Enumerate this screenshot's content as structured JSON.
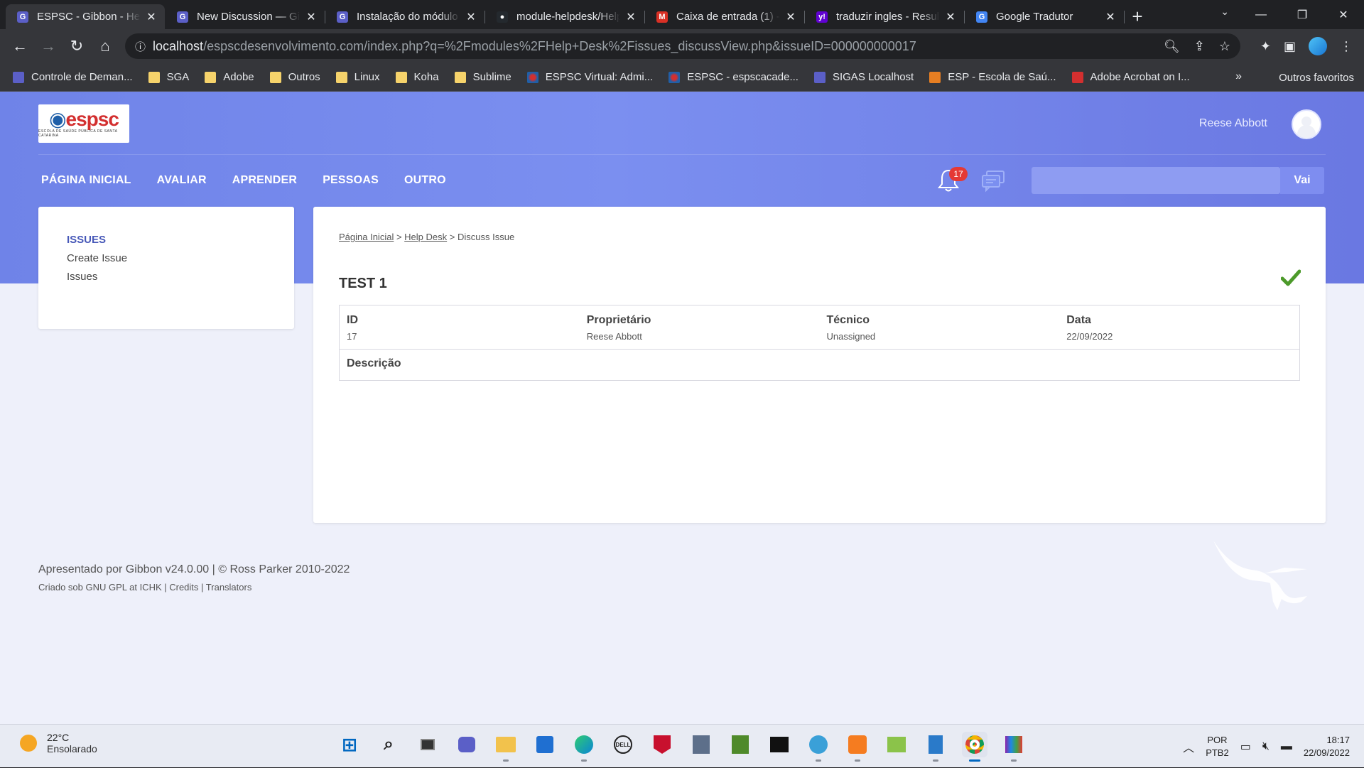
{
  "browser": {
    "tabs": [
      {
        "title": "ESPSC - Gibbon - Help Desk",
        "favicon": "G",
        "color": "#5b5fc7",
        "active": true
      },
      {
        "title": "New Discussion — Gibbon",
        "favicon": "G",
        "color": "#5b5fc7"
      },
      {
        "title": "Instalação do módulo",
        "favicon": "G",
        "color": "#5b5fc7"
      },
      {
        "title": "module-helpdesk/Help",
        "favicon": "●",
        "color": "#24292e"
      },
      {
        "title": "Caixa de entrada (1) -",
        "favicon": "M",
        "color": "#d93025"
      },
      {
        "title": "traduzir ingles - Resul",
        "favicon": "y!",
        "color": "#6001d2"
      },
      {
        "title": "Google Tradutor",
        "favicon": "G",
        "color": "#4285f4"
      }
    ],
    "url_host": "localhost",
    "url_path": "/espscdesenvolvimento.com/index.php?q=%2Fmodules%2FHelp+Desk%2Fissues_discussView.php&issueID=000000000017",
    "bookmarks": [
      {
        "label": "Controle de Deman...",
        "icon": "purple"
      },
      {
        "label": "SGA",
        "icon": "folder"
      },
      {
        "label": "Adobe",
        "icon": "folder"
      },
      {
        "label": "Outros",
        "icon": "folder"
      },
      {
        "label": "Linux",
        "icon": "folder"
      },
      {
        "label": "Koha",
        "icon": "folder"
      },
      {
        "label": "Sublime",
        "icon": "folder"
      },
      {
        "label": "ESPSC Virtual: Admi...",
        "icon": "espsc"
      },
      {
        "label": "ESPSC - espscacade...",
        "icon": "espsc"
      },
      {
        "label": "SIGAS Localhost",
        "icon": "gibbon"
      },
      {
        "label": "ESP - Escola de Saú...",
        "icon": "esp"
      },
      {
        "label": "Adobe Acrobat on I...",
        "icon": "acrobat"
      }
    ],
    "bookmarks_more": "»",
    "bookmarks_other": "Outros favoritos"
  },
  "header": {
    "logo_text": "espsc",
    "logo_sub": "ESCOLA DE SAÚDE PÚBLICA DE SANTA CATARINA",
    "user_name": "Reese Abbott",
    "nav": [
      "PÁGINA INICIAL",
      "AVALIAR",
      "APRENDER",
      "PESSOAS",
      "OUTRO"
    ],
    "notification_count": "17",
    "search_button": "Vai"
  },
  "sidebar": {
    "heading": "ISSUES",
    "items": [
      "Create Issue",
      "Issues"
    ]
  },
  "main": {
    "breadcrumb": {
      "home": "Página Inicial",
      "section": "Help Desk",
      "sep": ">",
      "current": "Discuss Issue"
    },
    "issue_title": "TEST 1",
    "fields": [
      {
        "label": "ID",
        "value": "17"
      },
      {
        "label": "Proprietário",
        "value": "Reese Abbott"
      },
      {
        "label": "Técnico",
        "value": "Unassigned"
      },
      {
        "label": "Data",
        "value": "22/09/2022"
      }
    ],
    "description_label": "Descrição"
  },
  "footer": {
    "line1": "Apresentado por Gibbon v24.0.00 | © Ross Parker 2010-2022",
    "line2_prefix": "Criado sob GNU GPL at ICHK | ",
    "credits": "Credits",
    "sep": " | ",
    "translators": "Translators"
  },
  "taskbar": {
    "temp": "22°C",
    "condition": "Ensolarado",
    "lang1": "POR",
    "lang2": "PTB2",
    "time": "18:17",
    "date": "22/09/2022"
  }
}
